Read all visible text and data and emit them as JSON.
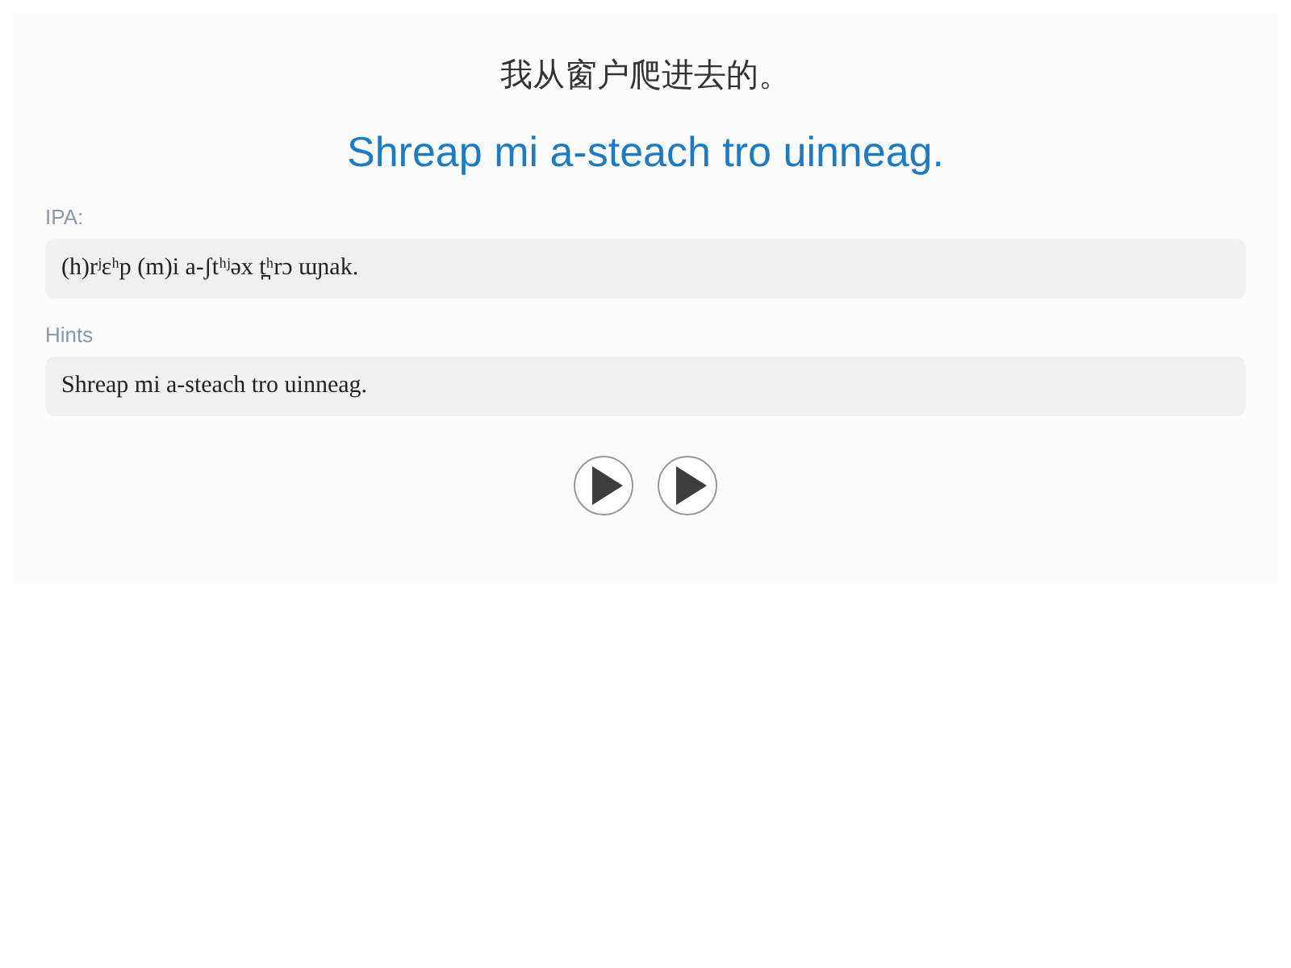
{
  "prompt": "我从窗户爬进去的。",
  "translation": "Shreap mi a-steach tro uinneag.",
  "fields": [
    {
      "label": "IPA:",
      "value": "(h)rʲɛʰp (m)i a-ʃtʰʲəx t̪ʰrɔ ɯɲak."
    },
    {
      "label": "Hints",
      "value": "Shreap mi a-steach tro uinneag."
    }
  ],
  "play_buttons": [
    {
      "kind": "play"
    },
    {
      "kind": "play"
    }
  ]
}
